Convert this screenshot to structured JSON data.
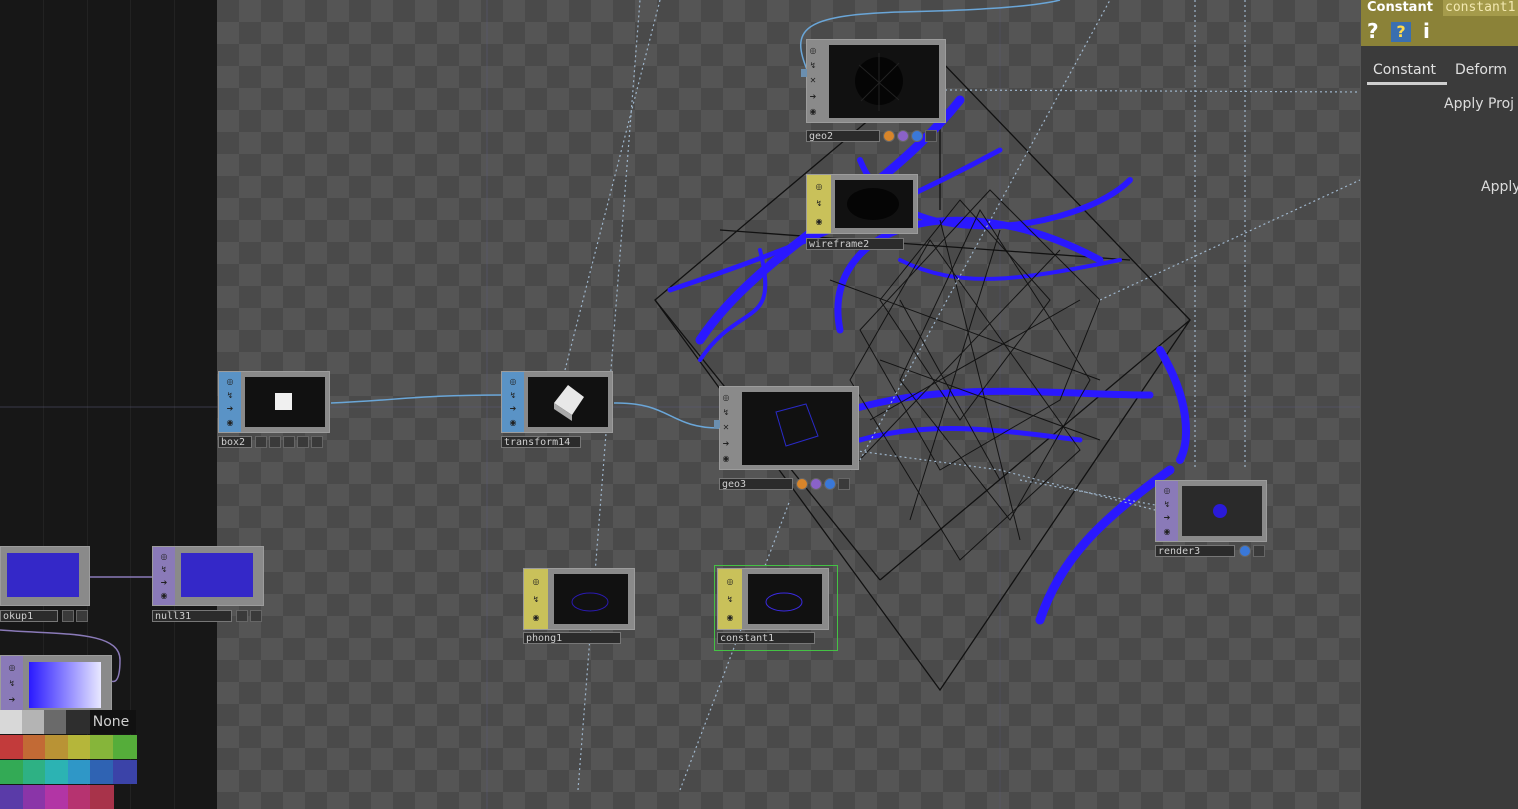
{
  "nodes": [
    {
      "id": "geo2",
      "label": "geo2",
      "family": "COMP"
    },
    {
      "id": "wireframe2",
      "label": "wireframe2",
      "family": "MAT"
    },
    {
      "id": "box2",
      "label": "box2",
      "family": "SOP"
    },
    {
      "id": "transform14",
      "label": "transform14",
      "family": "SOP"
    },
    {
      "id": "geo3",
      "label": "geo3",
      "family": "COMP"
    },
    {
      "id": "render3",
      "label": "render3",
      "family": "TOP"
    },
    {
      "id": "phong1",
      "label": "phong1",
      "family": "MAT"
    },
    {
      "id": "constant1",
      "label": "constant1",
      "family": "MAT",
      "selected": true
    },
    {
      "id": "lookup1",
      "label": "okup1",
      "family": "TOP"
    },
    {
      "id": "null31",
      "label": "null31",
      "family": "TOP"
    },
    {
      "id": "ramp",
      "label": "",
      "family": "TOP"
    }
  ],
  "family_colors": {
    "COMP": "#8a8a8a",
    "SOP": "#5a93c6",
    "MAT": "#c9c15a",
    "TOP": "#8a7ab8"
  },
  "params": {
    "op_type": "Constant",
    "op_name": "constant1",
    "help_icon": "question-icon",
    "python_help_icon": "python-help-icon",
    "info_icon": "info-icon",
    "tabs": [
      "Constant",
      "Deform"
    ],
    "active_tab": "Constant",
    "rows": [
      "Apply Proj",
      "Apply"
    ]
  },
  "color_palette": {
    "none_label": "None",
    "swatches": [
      "#d8d8d8",
      "#b4b4b4",
      "#6a6a6a",
      "#2e2e2e",
      "#c23b3b",
      "#c26a35",
      "#b99335",
      "#b5b63a",
      "#86b53a",
      "#55ad3a",
      "#33aa55",
      "#2eb184",
      "#2cb3b3",
      "#2f97c7",
      "#2f63b3",
      "#3b43a8",
      "#5a3ba8",
      "#8a35a8",
      "#b235a5",
      "#b63370",
      "#a8334a"
    ]
  }
}
